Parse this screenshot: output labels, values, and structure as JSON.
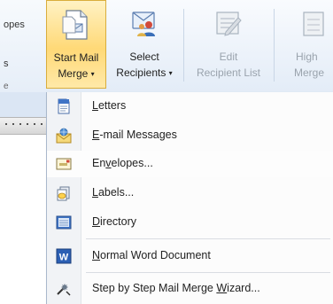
{
  "left": {
    "line1": "opes",
    "line2": "s",
    "line3": "e"
  },
  "ribbon": {
    "start_mail_merge": {
      "line1": "Start Mail",
      "line2": "Merge",
      "caret": "▾"
    },
    "select_recipients": {
      "line1": "Select",
      "line2": "Recipients",
      "caret": "▾"
    },
    "edit_recipient_list": {
      "line1": "Edit",
      "line2": "Recipient List"
    },
    "highlight_merge": {
      "line1": "High",
      "line2": "Merge"
    }
  },
  "menu": {
    "items": [
      {
        "label_pre": "",
        "label_ul": "L",
        "label_post": "etters"
      },
      {
        "label_pre": "",
        "label_ul": "E",
        "label_post": "-mail Messages"
      },
      {
        "label_pre": "En",
        "label_ul": "v",
        "label_post": "elopes..."
      },
      {
        "label_pre": "",
        "label_ul": "L",
        "label_post": "abels..."
      },
      {
        "label_pre": "",
        "label_ul": "D",
        "label_post": "irectory"
      },
      {
        "label_pre": "",
        "label_ul": "N",
        "label_post": "ormal Word Document"
      },
      {
        "label_pre": "Step by Step Mail Merge ",
        "label_ul": "W",
        "label_post": "izard..."
      }
    ]
  },
  "colors": {
    "active_button": "#ffd977",
    "menu_background": "#fcfcfc",
    "ribbon_background": "#e3ecf7"
  }
}
